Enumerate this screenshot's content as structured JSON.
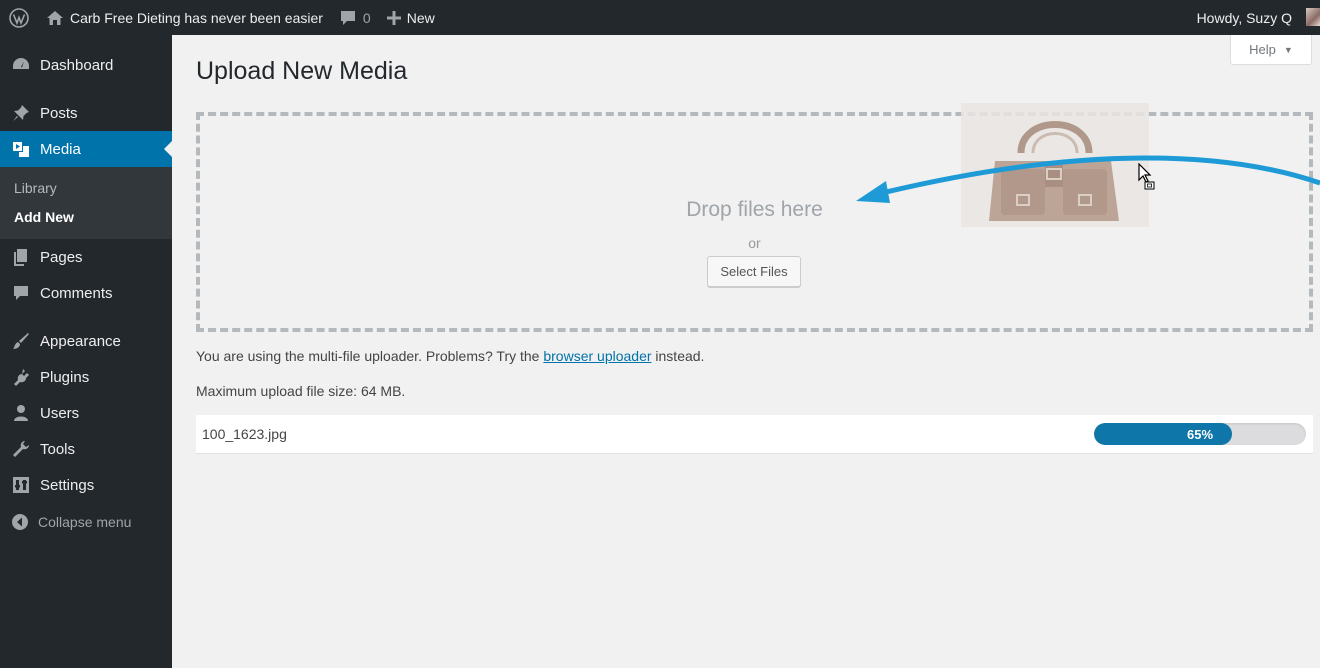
{
  "adminbar": {
    "site_name": "Carb Free Dieting has never been easier",
    "comments_count": "0",
    "new_label": "New",
    "greeting": "Howdy, Suzy Q"
  },
  "sidebar": {
    "items": [
      {
        "label": "Dashboard",
        "icon": "dashboard-icon"
      },
      {
        "label": "Posts",
        "icon": "pin-icon"
      },
      {
        "label": "Media",
        "icon": "media-icon"
      },
      {
        "label": "Pages",
        "icon": "pages-icon"
      },
      {
        "label": "Comments",
        "icon": "comment-icon"
      },
      {
        "label": "Appearance",
        "icon": "brush-icon"
      },
      {
        "label": "Plugins",
        "icon": "plug-icon"
      },
      {
        "label": "Users",
        "icon": "user-icon"
      },
      {
        "label": "Tools",
        "icon": "wrench-icon"
      },
      {
        "label": "Settings",
        "icon": "settings-icon"
      }
    ],
    "media_submenu": [
      "Library",
      "Add New"
    ],
    "collapse_label": "Collapse menu"
  },
  "help": {
    "label": "Help"
  },
  "page": {
    "title": "Upload New Media",
    "drop_text": "Drop files here",
    "or_text": "or",
    "select_files": "Select Files",
    "uploader_prefix": "You are using the multi-file uploader. Problems? Try the",
    "uploader_link": "browser uploader",
    "uploader_suffix": "instead.",
    "max_size": "Maximum upload file size: 64 MB."
  },
  "upload": {
    "file_name": "100_1623.jpg",
    "progress_text": "65%",
    "progress_value": 0.65
  },
  "colors": {
    "admin_dark": "#23282d",
    "accent": "#0073aa",
    "arrow": "#1e9bd7"
  }
}
